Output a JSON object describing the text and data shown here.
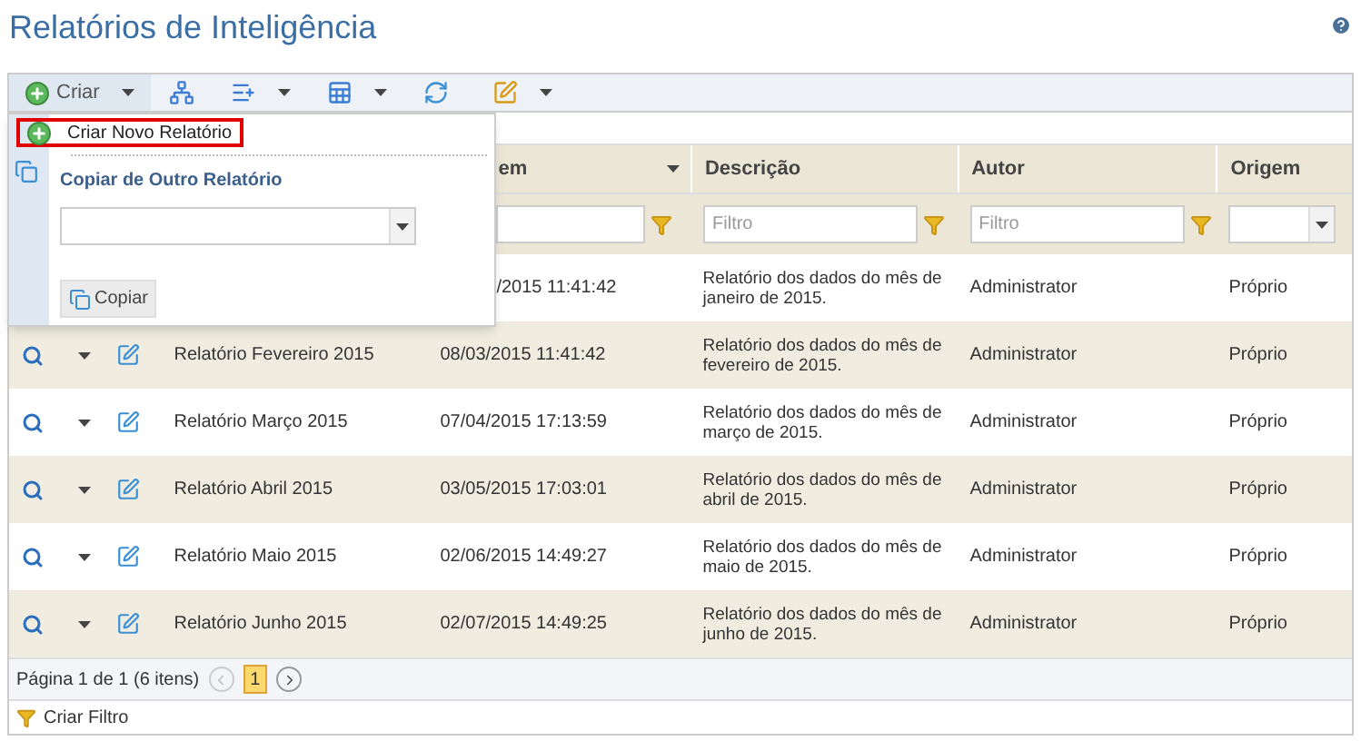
{
  "page": {
    "title": "Relatórios de Inteligência"
  },
  "toolbar": {
    "create_label": "Criar"
  },
  "create_menu": {
    "items": [
      {
        "label": "Criar Novo Relatório",
        "selected": true
      }
    ],
    "copy_heading": "Copiar de Outro Relatório",
    "copy_button": "Copiar"
  },
  "table": {
    "columns": [
      {
        "label": "em",
        "sortable": true
      },
      {
        "label": "Descrição",
        "sortable": false
      },
      {
        "label": "Autor",
        "sortable": false
      },
      {
        "label": "Origem",
        "sortable": false
      }
    ],
    "filters": [
      {
        "placeholder": "Filtro"
      },
      {
        "placeholder": "Filtro"
      }
    ],
    "rows": [
      {
        "date": "/2015 11:41:42",
        "description": "Relatório dos dados do mês de janeiro de 2015.",
        "author": "Administrator",
        "origin": "Próprio"
      },
      {
        "name": "Relatório Fevereiro 2015",
        "date": "08/03/2015 11:41:42",
        "description": "Relatório dos dados do mês de fevereiro de 2015.",
        "author": "Administrator",
        "origin": "Próprio"
      },
      {
        "name": "Relatório Março 2015",
        "date": "07/04/2015 17:13:59",
        "description": "Relatório dos dados do mês de março de 2015.",
        "author": "Administrator",
        "origin": "Próprio"
      },
      {
        "name": "Relatório Abril 2015",
        "date": "03/05/2015 17:03:01",
        "description": "Relatório dos dados do mês de abril de 2015.",
        "author": "Administrator",
        "origin": "Próprio"
      },
      {
        "name": "Relatório Maio 2015",
        "date": "02/06/2015 14:49:27",
        "description": "Relatório dos dados do mês de maio de 2015.",
        "author": "Administrator",
        "origin": "Próprio"
      },
      {
        "name": "Relatório Junho 2015",
        "date": "02/07/2015 14:49:25",
        "description": "Relatório dos dados do mês de junho de 2015.",
        "author": "Administrator",
        "origin": "Próprio"
      }
    ]
  },
  "pagination": {
    "summary": "Página 1 de 1 (6 itens)",
    "pages": [
      {
        "label": "1",
        "selected": true
      }
    ]
  },
  "footer": {
    "create_filter": "Criar Filtro"
  }
}
